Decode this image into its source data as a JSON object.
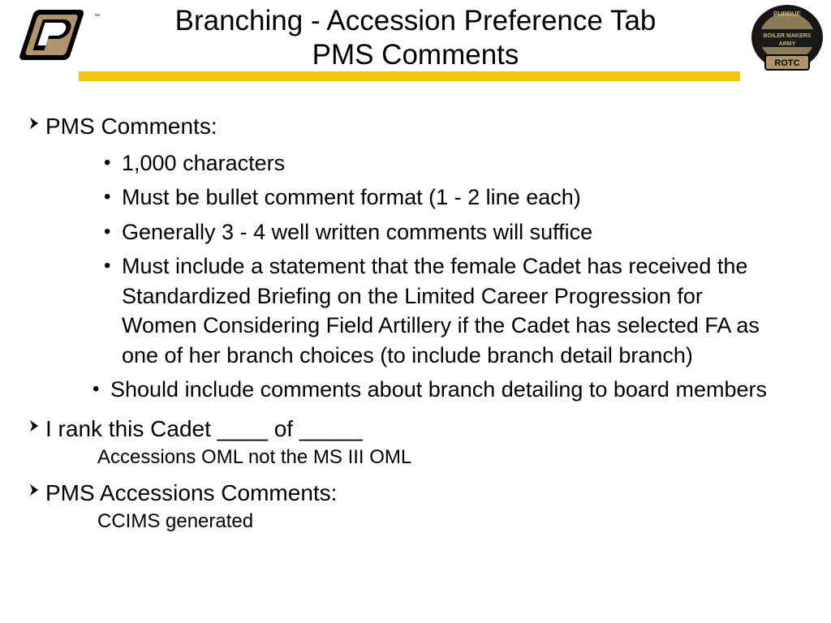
{
  "header": {
    "title_line1": "Branching - Accession Preference Tab",
    "title_line2": "PMS Comments",
    "left_logo_alt": "Purdue P Logo",
    "right_logo_alt": "Boilermakers Army ROTC Badge",
    "gold_bar_color": "#f2c310"
  },
  "body": {
    "section1": {
      "heading": "PMS Comments:",
      "bullets": [
        "1,000 characters",
        "Must be bullet comment format (1 - 2 line each)",
        "Generally 3 - 4 well written comments will suffice",
        "Must include a statement that the female Cadet has received the Standardized Briefing on the Limited Career Progression for Women Considering Field Artillery if the Cadet has selected FA as one of her branch choices (to include branch detail branch)",
        "Should include comments about branch detailing to board members"
      ]
    },
    "section2": {
      "heading": "I rank this Cadet ____   of  _____",
      "note": "Accessions OML not the MS III OML"
    },
    "section3": {
      "heading": "PMS Accessions Comments:",
      "note": "CCIMS generated"
    }
  }
}
